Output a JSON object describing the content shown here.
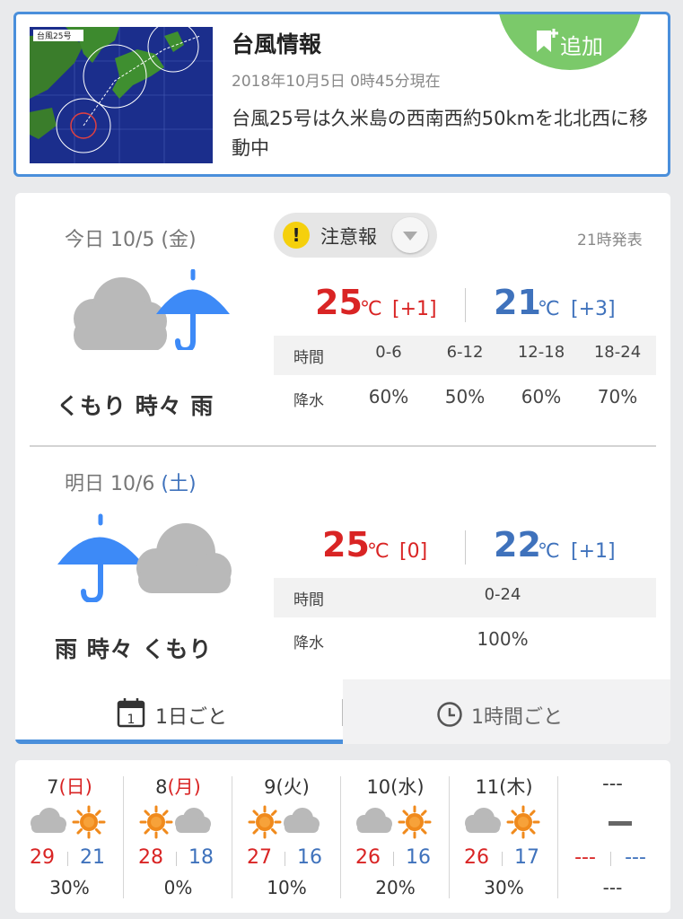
{
  "typhoon": {
    "map_label": "台風25号",
    "title": "台風情報",
    "date": "2018年10月5日 0時45分現在",
    "description": "台風25号は久米島の西南西約50kmを北北西に移動中",
    "add_label": "追加",
    "add_icon": "bookmark-plus-icon"
  },
  "today": {
    "label_prefix": "今日 10/5 (金)",
    "condition": "くもり 時々 雨",
    "icons": [
      "cloud-icon",
      "umbrella-icon"
    ],
    "alert_label": "注意報",
    "alert_mark": "!",
    "issued": "21時発表",
    "high": "25",
    "high_unit": "℃",
    "high_diff": "[+1]",
    "low": "21",
    "low_unit": "℃",
    "low_diff": "[+3]",
    "table": {
      "time_label": "時間",
      "rain_label": "降水",
      "times": [
        "0-6",
        "6-12",
        "12-18",
        "18-24"
      ],
      "rain": [
        "60%",
        "50%",
        "60%",
        "70%"
      ]
    }
  },
  "tomorrow": {
    "label_prefix": "明日 10/6 ",
    "label_dow": "(土)",
    "condition": "雨 時々 くもり",
    "icons": [
      "umbrella-icon",
      "cloud-icon"
    ],
    "high": "25",
    "high_unit": "℃",
    "high_diff": "[0]",
    "low": "22",
    "low_unit": "℃",
    "low_diff": "[+1]",
    "table": {
      "time_label": "時間",
      "rain_label": "降水",
      "times": [
        "0-24"
      ],
      "rain": [
        "100%"
      ]
    }
  },
  "tabs": {
    "daily_label": "1日ごと",
    "daily_icon": "calendar-icon",
    "daily_icon_text": "1",
    "hourly_label": "1時間ごと",
    "hourly_icon": "clock-icon"
  },
  "weekly": [
    {
      "day": "7",
      "dow": "(日)",
      "dow_red": true,
      "icon": "cloud-sun-icon",
      "high": "29",
      "low": "21",
      "pop": "30%"
    },
    {
      "day": "8",
      "dow": "(月)",
      "dow_red": true,
      "icon": "sun-cloud-icon",
      "high": "28",
      "low": "18",
      "pop": "0%"
    },
    {
      "day": "9",
      "dow": "(火)",
      "dow_red": false,
      "icon": "sun-cloud-icon",
      "high": "27",
      "low": "16",
      "pop": "10%"
    },
    {
      "day": "10",
      "dow": "(水)",
      "dow_red": false,
      "icon": "cloud-sun-icon",
      "high": "26",
      "low": "16",
      "pop": "20%"
    },
    {
      "day": "11",
      "dow": "(木)",
      "dow_red": false,
      "icon": "cloud-sun-icon",
      "high": "26",
      "low": "17",
      "pop": "30%"
    },
    {
      "day": "---",
      "dow": "",
      "dow_red": false,
      "icon": "dash-icon",
      "high": "---",
      "low": "---",
      "pop": "---"
    }
  ],
  "colors": {
    "accent": "#4a8fdb",
    "add_green": "#7bc96a",
    "high_red": "#d92424",
    "low_blue": "#3f72bc",
    "umbrella_blue": "#3d8af7",
    "cloud_gray": "#b9b9b9",
    "sun_orange": "#f08a1c"
  }
}
